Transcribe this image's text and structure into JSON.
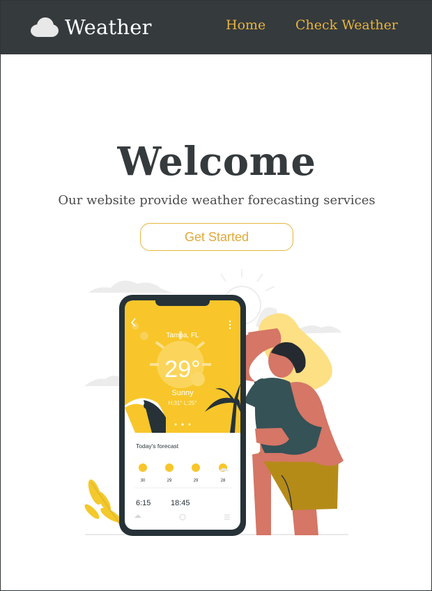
{
  "nav": {
    "brand": "Weather",
    "links": [
      "Home",
      "Check Weather"
    ]
  },
  "hero": {
    "title": "Welcome",
    "subtitle": "Our website provide weather forecasting services",
    "cta": "Get Started"
  },
  "illustration": {
    "phone": {
      "location": "Tampa, FL",
      "temperature": "29°",
      "condition": "Sunny",
      "hi_lo": "H:31°   L:25°",
      "forecast_heading": "Today's forecast",
      "forecast": [
        "30",
        "29",
        "29",
        "28"
      ],
      "sunrise": "6:15",
      "sunset": "18:45"
    }
  },
  "colors": {
    "nav_bg": "#353a3d",
    "accent": "#e7b43c",
    "phone_yellow": "#f8c62a",
    "skin": "#d57666"
  }
}
